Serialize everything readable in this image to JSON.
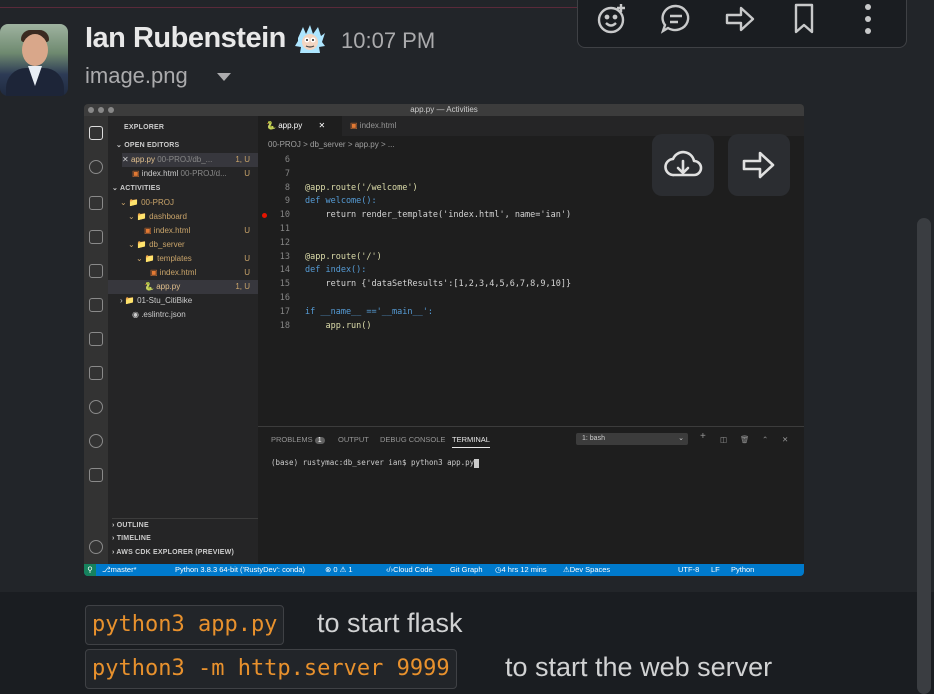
{
  "message": {
    "author": "Ian Rubenstein",
    "time": "10:07 PM",
    "attachment_name": "image.png"
  },
  "actions": [
    {
      "icon": "add-reaction-icon"
    },
    {
      "icon": "reply-in-thread-icon"
    },
    {
      "icon": "share-icon"
    },
    {
      "icon": "bookmark-icon"
    },
    {
      "icon": "more-actions-icon"
    }
  ],
  "screenshot": {
    "window_title": "app.py — Activities",
    "explorer": {
      "title": "EXPLORER",
      "open_editors": "OPEN EDITORS",
      "open_files": [
        {
          "name": "app.py",
          "path": "00-PROJ/db_...",
          "badge": "1, U"
        },
        {
          "name": "index.html",
          "path": "00-PROJ/d...",
          "badge": "U"
        }
      ],
      "activities": "ACTIVITIES",
      "tree": [
        {
          "name": "00-PROJ",
          "badge": ""
        },
        {
          "name": "dashboard",
          "badge": ""
        },
        {
          "name": "index.html",
          "badge": "U"
        },
        {
          "name": "db_server",
          "badge": ""
        },
        {
          "name": "templates",
          "badge": "U"
        },
        {
          "name": "index.html",
          "badge": "U"
        },
        {
          "name": "app.py",
          "badge": "1, U"
        },
        {
          "name": "01-Stu_CitiBike",
          "badge": ""
        },
        {
          "name": ".eslintrc.json",
          "badge": ""
        }
      ],
      "outline": "OUTLINE",
      "timeline": "TIMELINE",
      "aws": "AWS CDK EXPLORER (PREVIEW)"
    },
    "tabs": [
      "app.py",
      "index.html"
    ],
    "breadcrumb": "00-PROJ > db_server > app.py > ...",
    "code_lines": [
      {
        "n": "6",
        "t": ""
      },
      {
        "n": "7",
        "t": ""
      },
      {
        "n": "8",
        "t": "@app.route('/welcome')"
      },
      {
        "n": "9",
        "t": "def welcome():"
      },
      {
        "n": "10",
        "t": "    return render_template('index.html', name='ian')"
      },
      {
        "n": "11",
        "t": ""
      },
      {
        "n": "12",
        "t": ""
      },
      {
        "n": "13",
        "t": "@app.route('/')"
      },
      {
        "n": "14",
        "t": "def index():"
      },
      {
        "n": "15",
        "t": "    return {'dataSetResults':[1,2,3,4,5,6,7,8,9,10]}"
      },
      {
        "n": "16",
        "t": ""
      },
      {
        "n": "17",
        "t": "if __name__ =='__main__':"
      },
      {
        "n": "18",
        "t": "    app.run()"
      }
    ],
    "panel_tabs": {
      "problems": "PROBLEMS",
      "problems_count": "1",
      "output": "OUTPUT",
      "debug": "DEBUG CONSOLE",
      "terminal": "TERMINAL"
    },
    "shell": "1: bash",
    "terminal_line": "(base) rustymac:db_server ian$ python3 app.py",
    "status": {
      "branch": "master*",
      "python": "Python 3.8.3 64-bit ('RustyDev': conda)",
      "problems": "⊗ 0 ⚠ 1",
      "cloud": "Cloud Code",
      "git": "Git Graph",
      "timer": "4 hrs 12 mins",
      "spaces": "Dev Spaces",
      "encoding": "UTF-8",
      "eol": "LF",
      "lang": "Python"
    }
  },
  "footer": {
    "line1_code": "python3 app.py",
    "line1_text": "to start flask",
    "line2_code": "python3 -m http.server 9999",
    "line2_text": "to start the web server"
  }
}
